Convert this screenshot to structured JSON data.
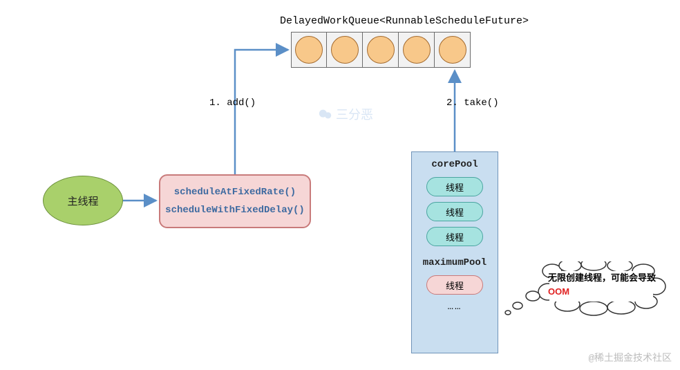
{
  "queue": {
    "title": "DelayedWorkQueue<RunnableScheduleFuture>",
    "slots": 5
  },
  "edges": {
    "add_label": "1. add()",
    "take_label": "2. take()"
  },
  "main_thread": {
    "label": "主线程"
  },
  "scheduler": {
    "method1": "scheduleAtFixedRate()",
    "method2": "scheduleWithFixedDelay()"
  },
  "pool": {
    "core_label": "corePool",
    "max_label": "maximumPool",
    "thread_label": "线程",
    "ellipsis": "……"
  },
  "thought": {
    "prefix": "无限创建线程，可能会导致",
    "oom": "OOM"
  },
  "watermark": {
    "top": "三分恶",
    "bottom": "@稀土掘金技术社区"
  }
}
